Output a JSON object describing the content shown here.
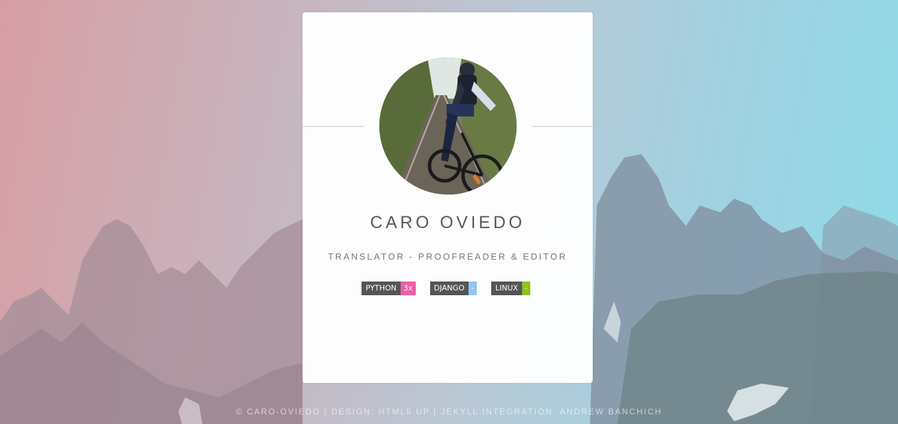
{
  "profile": {
    "name": "CARO OVIEDO",
    "role": "TRANSLATOR - PROOFREADER & EDITOR"
  },
  "badges": [
    {
      "key": "PYTHON",
      "value": "3x",
      "color": "#ea5da5"
    },
    {
      "key": "DJANGO",
      "value": "-",
      "color": "#92c4f3"
    },
    {
      "key": "LINUX",
      "value": "-",
      "color": "#8ec11f"
    }
  ],
  "footer": {
    "text": "© CARO-OVIEDO | DESIGN: HTML5 UP | JEKYLL INTEGRATION: ANDREW BANCHICH"
  },
  "colors": {
    "badge_key_bg": "#555555",
    "card_bg": "#ffffff"
  },
  "icons": {
    "avatar": "profile-photo-cyclist"
  }
}
